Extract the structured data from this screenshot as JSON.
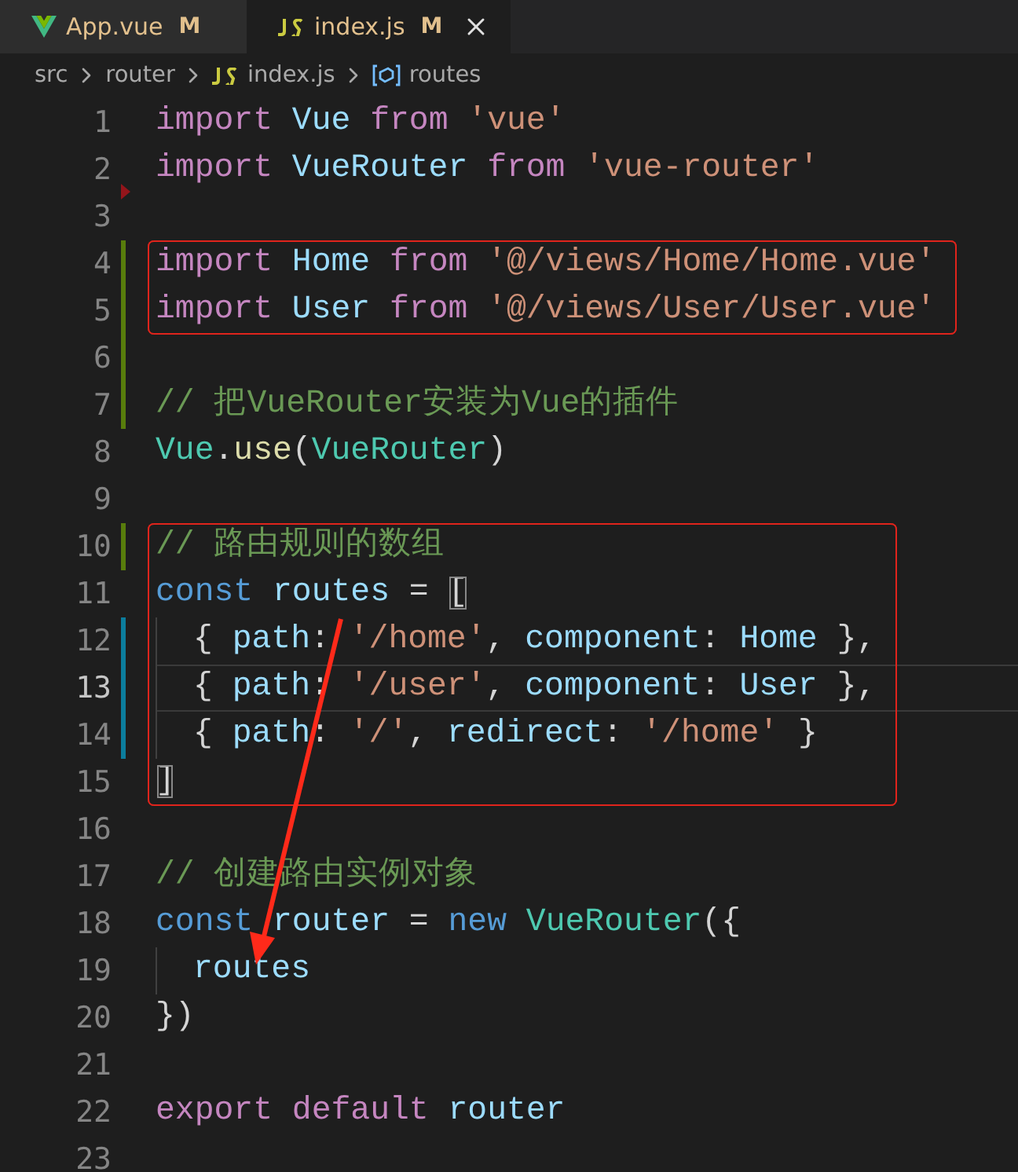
{
  "tabs": [
    {
      "label": "App.vue",
      "kind": "vue",
      "badge": "M",
      "selected": false
    },
    {
      "label": "index.js",
      "kind": "js",
      "badge": "M",
      "selected": true
    }
  ],
  "breadcrumb": [
    {
      "label": "src",
      "kind": "folder"
    },
    {
      "label": "router",
      "kind": "folder"
    },
    {
      "label": "index.js",
      "kind": "js"
    },
    {
      "label": "routes",
      "kind": "symbol"
    }
  ],
  "lines": [
    {
      "number": "1",
      "kind": "unchanged",
      "highlighted": false,
      "current": false,
      "tokens": [
        {
          "kind": "keyword",
          "s": "import "
        },
        {
          "kind": "variable",
          "s": "Vue "
        },
        {
          "kind": "keyword",
          "s": "from "
        },
        {
          "kind": "string",
          "s": "'vue'"
        }
      ]
    },
    {
      "number": "2",
      "kind": "unchanged",
      "highlighted": false,
      "current": false,
      "tokens": [
        {
          "kind": "keyword",
          "s": "import "
        },
        {
          "kind": "variable",
          "s": "VueRouter "
        },
        {
          "kind": "keyword",
          "s": "from "
        },
        {
          "kind": "string",
          "s": "'vue-router'"
        }
      ]
    },
    {
      "number": "3",
      "kind": "deleted",
      "current": false
    },
    {
      "number": "4",
      "kind": "added",
      "highlighted": true,
      "current": false,
      "tokens": [
        {
          "kind": "keyword",
          "s": "import "
        },
        {
          "kind": "variable",
          "s": "Home "
        },
        {
          "kind": "keyword",
          "s": "from "
        },
        {
          "kind": "string",
          "s": "'@/views/Home/Home.vue'"
        }
      ]
    },
    {
      "number": "5",
      "kind": "added",
      "highlighted": true,
      "current": false,
      "tokens": [
        {
          "kind": "keyword",
          "s": "import "
        },
        {
          "kind": "variable",
          "s": "User "
        },
        {
          "kind": "keyword",
          "s": "from "
        },
        {
          "kind": "string",
          "s": "'@/views/User/User.vue'"
        }
      ]
    },
    {
      "number": "6",
      "kind": "added",
      "current": false
    },
    {
      "number": "7",
      "kind": "added",
      "highlighted": false,
      "current": false,
      "tokens": [
        {
          "kind": "comment",
          "s": "// 把VueRouter安装为Vue的插件"
        }
      ]
    },
    {
      "number": "8",
      "kind": "unchanged",
      "highlighted": false,
      "current": false,
      "tokens": [
        {
          "kind": "class",
          "s": "Vue"
        },
        {
          "kind": "plain",
          "s": "."
        },
        {
          "kind": "function",
          "s": "use"
        },
        {
          "kind": "plain",
          "s": "("
        },
        {
          "kind": "class",
          "s": "VueRouter"
        },
        {
          "kind": "plain",
          "s": ")"
        }
      ]
    },
    {
      "number": "9",
      "kind": "unchanged",
      "current": false
    },
    {
      "number": "10",
      "kind": "added",
      "highlighted": true,
      "current": false,
      "tokens": [
        {
          "kind": "comment",
          "s": "// 路由规则的数组"
        }
      ]
    },
    {
      "number": "11",
      "kind": "unchanged",
      "highlighted": true,
      "current": false,
      "tokens": [
        {
          "kind": "storage",
          "s": "const "
        },
        {
          "kind": "variable",
          "s": "routes "
        },
        {
          "kind": "plain",
          "s": "= "
        },
        {
          "kind": "bracket_match",
          "s": "["
        }
      ]
    },
    {
      "number": "12",
      "kind": "modified",
      "highlighted": true,
      "current": false,
      "indented": true,
      "tokens": [
        {
          "kind": "plain",
          "s": "{ "
        },
        {
          "kind": "variable",
          "s": "path"
        },
        {
          "kind": "plain",
          "s": ": "
        },
        {
          "kind": "string",
          "s": "'/home'"
        },
        {
          "kind": "plain",
          "s": ", "
        },
        {
          "kind": "variable",
          "s": "component"
        },
        {
          "kind": "plain",
          "s": ": "
        },
        {
          "kind": "variable",
          "s": "Home"
        },
        {
          "kind": "plain",
          "s": " },"
        }
      ]
    },
    {
      "number": "13",
      "kind": "modified",
      "highlighted": true,
      "current": true,
      "indented": true,
      "tokens": [
        {
          "kind": "plain",
          "s": "{ "
        },
        {
          "kind": "variable",
          "s": "path"
        },
        {
          "kind": "plain",
          "s": ": "
        },
        {
          "kind": "string",
          "s": "'/user'"
        },
        {
          "kind": "plain",
          "s": ", "
        },
        {
          "kind": "variable",
          "s": "component"
        },
        {
          "kind": "plain",
          "s": ": "
        },
        {
          "kind": "variable",
          "s": "User"
        },
        {
          "kind": "plain",
          "s": " },"
        }
      ]
    },
    {
      "number": "14",
      "kind": "modified",
      "highlighted": true,
      "current": false,
      "indented": true,
      "tokens": [
        {
          "kind": "plain",
          "s": "{ "
        },
        {
          "kind": "variable",
          "s": "path"
        },
        {
          "kind": "plain",
          "s": ": "
        },
        {
          "kind": "string",
          "s": "'/'"
        },
        {
          "kind": "plain",
          "s": ", "
        },
        {
          "kind": "variable",
          "s": "redirect"
        },
        {
          "kind": "plain",
          "s": ": "
        },
        {
          "kind": "string",
          "s": "'/home'"
        },
        {
          "kind": "plain",
          "s": " }"
        }
      ]
    },
    {
      "number": "15",
      "kind": "unchanged",
      "highlighted": true,
      "current": false,
      "tokens": [
        {
          "kind": "bracket_match",
          "s": "]"
        }
      ]
    },
    {
      "number": "16",
      "kind": "unchanged",
      "current": false
    },
    {
      "number": "17",
      "kind": "unchanged",
      "highlighted": false,
      "current": false,
      "tokens": [
        {
          "kind": "comment",
          "s": "// 创建路由实例对象"
        }
      ]
    },
    {
      "number": "18",
      "kind": "unchanged",
      "highlighted": false,
      "current": false,
      "tokens": [
        {
          "kind": "storage",
          "s": "const "
        },
        {
          "kind": "variable",
          "s": "router "
        },
        {
          "kind": "plain",
          "s": "= "
        },
        {
          "kind": "storage",
          "s": "new "
        },
        {
          "kind": "class",
          "s": "VueRouter"
        },
        {
          "kind": "plain",
          "s": "({"
        }
      ]
    },
    {
      "number": "19",
      "kind": "unchanged",
      "highlighted": false,
      "current": false,
      "indented": true,
      "tokens": [
        {
          "kind": "variable",
          "s": "routes"
        }
      ]
    },
    {
      "number": "20",
      "kind": "unchanged",
      "highlighted": false,
      "current": false,
      "tokens": [
        {
          "kind": "plain",
          "s": "})"
        }
      ]
    },
    {
      "number": "21",
      "kind": "unchanged",
      "current": false
    },
    {
      "number": "22",
      "kind": "unchanged",
      "highlighted": false,
      "current": false,
      "tokens": [
        {
          "kind": "keyword",
          "s": "export "
        },
        {
          "kind": "keyword",
          "s": "default "
        },
        {
          "kind": "variable",
          "s": "router"
        }
      ]
    },
    {
      "number": "23",
      "kind": "unchanged",
      "current": false
    }
  ]
}
